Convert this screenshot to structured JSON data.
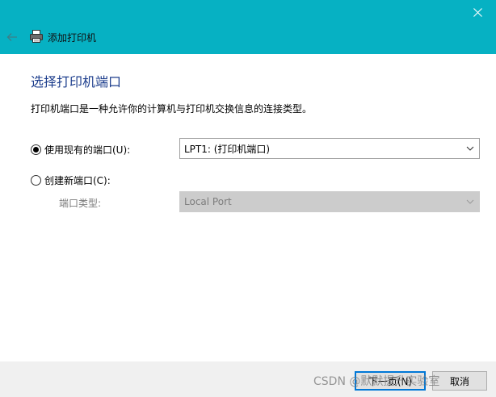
{
  "window": {
    "title": "添加打印机",
    "accent_color": "#06b1c3"
  },
  "icons": {
    "close": "close-icon",
    "back": "back-arrow-icon",
    "printer": "printer-icon",
    "dropdown": "chevron-down-icon"
  },
  "content": {
    "heading": "选择打印机端口",
    "description": "打印机端口是一种允许你的计算机与打印机交换信息的连接类型。",
    "existing_port": {
      "label": "使用现有的端口(U):",
      "selected": true,
      "value": "LPT1: (打印机端口)"
    },
    "new_port": {
      "label": "创建新端口(C):",
      "selected": false,
      "type_label": "端口类型:",
      "type_value": "Local Port",
      "disabled": true
    }
  },
  "footer": {
    "next_label": "下一页(N)",
    "cancel_label": "取消"
  },
  "watermark": "CSDN @默默提升实验室"
}
